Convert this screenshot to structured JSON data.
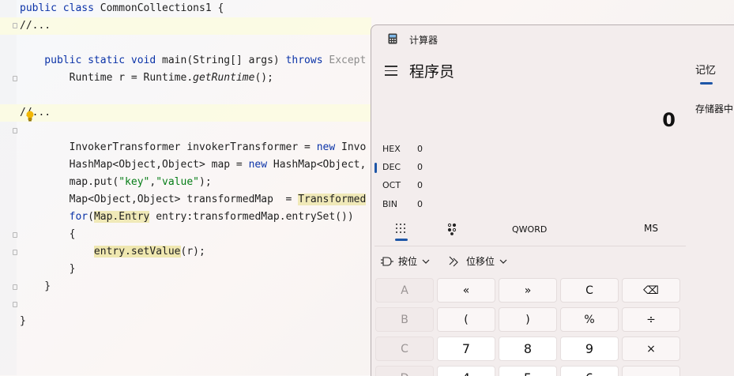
{
  "editor": {
    "lines": [
      {
        "parts": [
          {
            "t": "public ",
            "c": "kw"
          },
          {
            "t": "class ",
            "c": "kw"
          },
          {
            "t": "CommonCollections1 {",
            "c": "ty"
          }
        ]
      },
      {
        "parts": [
          {
            "t": "//...",
            "c": "ty"
          }
        ],
        "highlight": true
      },
      {
        "parts": []
      },
      {
        "parts": [
          {
            "t": "    public ",
            "c": "kw"
          },
          {
            "t": "static ",
            "c": "kw"
          },
          {
            "t": "void ",
            "c": "kw"
          },
          {
            "t": "main(String[] args) ",
            "c": "ty"
          },
          {
            "t": "throws ",
            "c": "kw"
          },
          {
            "t": "Except",
            "c": "gray"
          }
        ]
      },
      {
        "parts": [
          {
            "t": "        Runtime r = Runtime.",
            "c": "ty"
          },
          {
            "t": "getRuntime",
            "c": "fn-italic"
          },
          {
            "t": "();",
            "c": "ty"
          }
        ]
      },
      {
        "parts": []
      },
      {
        "parts": [
          {
            "t": "//...",
            "c": "ty"
          }
        ],
        "highlight": true
      },
      {
        "parts": []
      },
      {
        "parts": [
          {
            "t": "        InvokerTransformer invokerTransformer = ",
            "c": "ty"
          },
          {
            "t": "new ",
            "c": "kw"
          },
          {
            "t": "Invo",
            "c": "ty"
          }
        ]
      },
      {
        "parts": [
          {
            "t": "        HashMap<Object,Object> map = ",
            "c": "ty"
          },
          {
            "t": "new ",
            "c": "kw"
          },
          {
            "t": "HashMap<Object,",
            "c": "ty"
          }
        ]
      },
      {
        "parts": [
          {
            "t": "        map.put(",
            "c": "ty"
          },
          {
            "t": "\"key\"",
            "c": "str"
          },
          {
            "t": ",",
            "c": "ty"
          },
          {
            "t": "\"value\"",
            "c": "str"
          },
          {
            "t": ");",
            "c": "ty"
          }
        ]
      },
      {
        "parts": [
          {
            "t": "        Map<Object,Object> transformedMap  = ",
            "c": "ty"
          },
          {
            "t": "Transformed",
            "c": "param-hl"
          }
        ]
      },
      {
        "parts": [
          {
            "t": "        ",
            "c": "ty"
          },
          {
            "t": "for",
            "c": "kw"
          },
          {
            "t": "(",
            "c": "ty"
          },
          {
            "t": "Map.Entry",
            "c": "param-hl"
          },
          {
            "t": " entry:transformedMap.entrySet())",
            "c": "ty"
          }
        ]
      },
      {
        "parts": [
          {
            "t": "        {",
            "c": "ty"
          }
        ]
      },
      {
        "parts": [
          {
            "t": "            ",
            "c": "ty"
          },
          {
            "t": "entry.setValue",
            "c": "ent-hl"
          },
          {
            "t": "(r);",
            "c": "ty"
          }
        ]
      },
      {
        "parts": [
          {
            "t": "        }",
            "c": "ty"
          }
        ]
      },
      {
        "parts": [
          {
            "t": "    }",
            "c": "ty"
          }
        ]
      },
      {
        "parts": []
      },
      {
        "parts": [
          {
            "t": "}",
            "c": "ty"
          }
        ]
      }
    ]
  },
  "calculator": {
    "window_title": "计算器",
    "mode_title": "程序员",
    "display_value": "0",
    "radix": [
      {
        "label": "HEX",
        "value": "0"
      },
      {
        "label": "DEC",
        "value": "0"
      },
      {
        "label": "OCT",
        "value": "0"
      },
      {
        "label": "BIN",
        "value": "0"
      }
    ],
    "memory_tab": "记忆",
    "memory_empty": "存储器中",
    "word_size": "QWORD",
    "ms_label": "MS",
    "bitwise_label": "按位",
    "bitshift_label": "位移位",
    "keys": [
      [
        {
          "label": "A",
          "disabled": true
        },
        {
          "label": "«",
          "disabled": false
        },
        {
          "label": "»",
          "disabled": false
        },
        {
          "label": "C",
          "disabled": false
        },
        {
          "label": "⌫",
          "disabled": false
        }
      ],
      [
        {
          "label": "B",
          "disabled": true
        },
        {
          "label": "(",
          "disabled": false
        },
        {
          "label": ")",
          "disabled": false
        },
        {
          "label": "%",
          "disabled": false
        },
        {
          "label": "÷",
          "disabled": false
        }
      ],
      [
        {
          "label": "C",
          "disabled": true
        },
        {
          "label": "7",
          "disabled": false,
          "num": true
        },
        {
          "label": "8",
          "disabled": false,
          "num": true
        },
        {
          "label": "9",
          "disabled": false,
          "num": true
        },
        {
          "label": "×",
          "disabled": false
        }
      ],
      [
        {
          "label": "D",
          "disabled": true
        },
        {
          "label": "4",
          "disabled": false,
          "num": true
        },
        {
          "label": "5",
          "disabled": false,
          "num": true
        },
        {
          "label": "6",
          "disabled": false,
          "num": true
        },
        {
          "label": "−",
          "disabled": false
        }
      ]
    ]
  }
}
